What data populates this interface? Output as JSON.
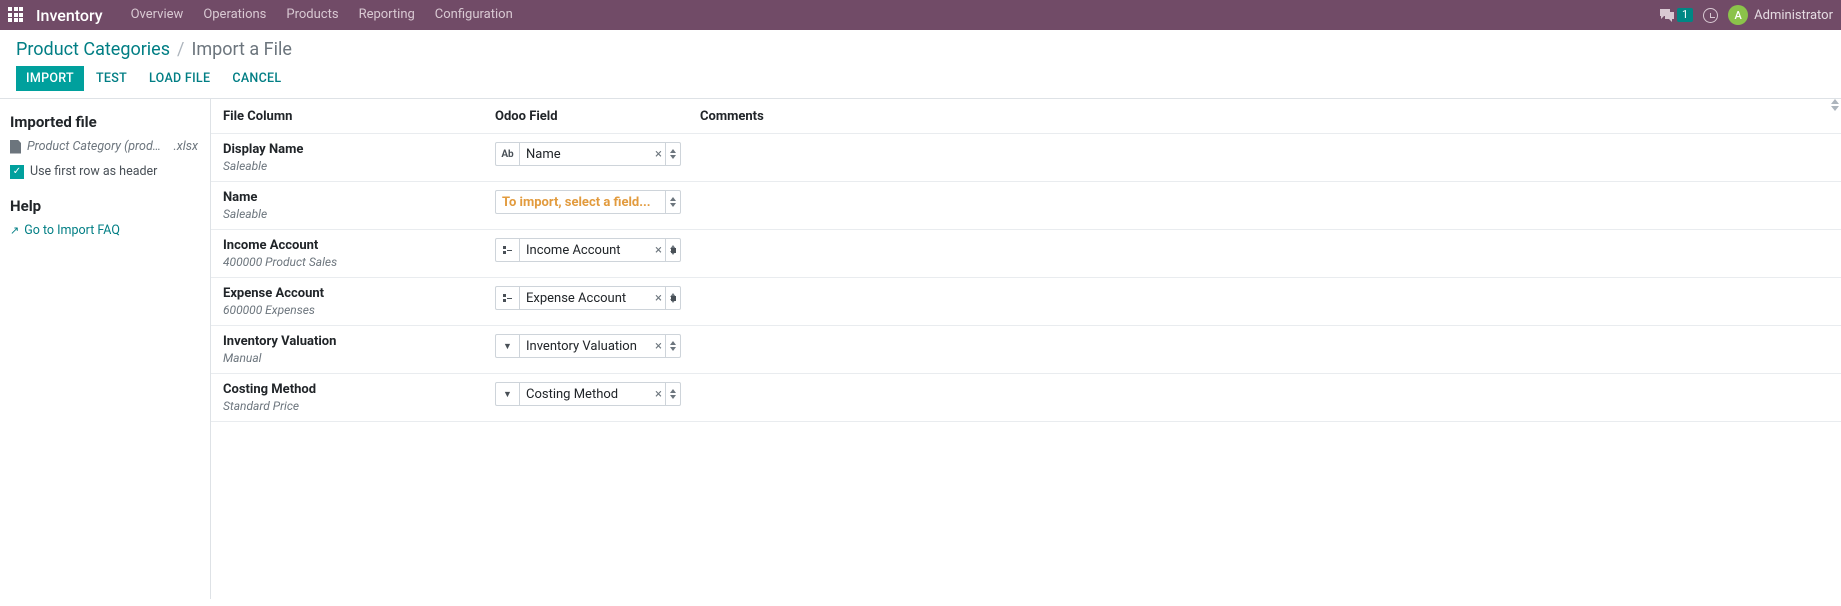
{
  "navbar": {
    "brand": "Inventory",
    "menu": [
      "Overview",
      "Operations",
      "Products",
      "Reporting",
      "Configuration"
    ],
    "msg_count": "1",
    "user_initial": "A",
    "user_name": "Administrator"
  },
  "breadcrumb": {
    "parent": "Product Categories",
    "current": "Import a File"
  },
  "buttons": {
    "import": "Import",
    "test": "Test",
    "load_file": "Load File",
    "cancel": "Cancel"
  },
  "sidebar": {
    "imported_file_heading": "Imported file",
    "file_name": "Product Category (product.c…",
    "file_ext": ".xlsx",
    "checkbox_label": "Use first row as header",
    "help_heading": "Help",
    "faq_link": "Go to Import FAQ"
  },
  "headers": {
    "file_column": "File Column",
    "odoo_field": "Odoo Field",
    "comments": "Comments"
  },
  "rows": [
    {
      "title": "Display Name",
      "sub": "Saleable",
      "field_type": "text",
      "field_badge": "Ab",
      "field_value": "Name",
      "placeholder": false,
      "clearable": true
    },
    {
      "title": "Name",
      "sub": "Saleable",
      "field_type": "none",
      "field_badge": "",
      "field_value": "To import, select a field...",
      "placeholder": true,
      "clearable": false
    },
    {
      "title": "Income Account",
      "sub": "400000 Product Sales",
      "field_type": "m2o",
      "field_badge": "",
      "field_value": "Income Account",
      "placeholder": false,
      "clearable": true
    },
    {
      "title": "Expense Account",
      "sub": "600000 Expenses",
      "field_type": "m2o",
      "field_badge": "",
      "field_value": "Expense Account",
      "placeholder": false,
      "clearable": true
    },
    {
      "title": "Inventory Valuation",
      "sub": "Manual",
      "field_type": "sel",
      "field_badge": "",
      "field_value": "Inventory Valuation",
      "placeholder": false,
      "clearable": true
    },
    {
      "title": "Costing Method",
      "sub": "Standard Price",
      "field_type": "sel",
      "field_badge": "",
      "field_value": "Costing Method",
      "placeholder": false,
      "clearable": true
    }
  ]
}
